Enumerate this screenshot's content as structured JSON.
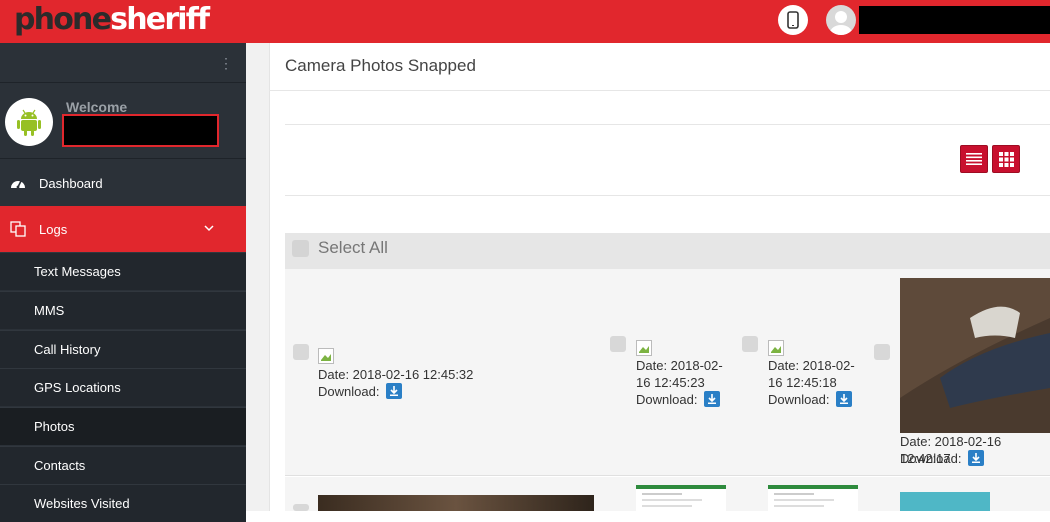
{
  "app": {
    "logo_phone": "phone",
    "logo_sheriff": "sheriff",
    "brand_color": "#e1272d"
  },
  "header": {
    "device_icon": "mobile-phone-icon",
    "avatar_icon": "user-avatar"
  },
  "sidebar": {
    "welcome": "Welcome",
    "profile_icon": "android-icon",
    "items": [
      {
        "label": "Dashboard",
        "icon": "dashboard-gauge-icon"
      },
      {
        "label": "Logs",
        "icon": "logs-copy-icon",
        "active": true,
        "expanded": true
      }
    ],
    "sub_items": [
      {
        "label": "Text Messages"
      },
      {
        "label": "MMS"
      },
      {
        "label": "Call History"
      },
      {
        "label": "GPS Locations"
      },
      {
        "label": "Photos",
        "active": true
      },
      {
        "label": "Contacts"
      },
      {
        "label": "Websites Visited"
      }
    ]
  },
  "main": {
    "title": "Camera Photos Snapped",
    "view_toggles": [
      {
        "icon": "list-view-icon"
      },
      {
        "icon": "grid-view-icon"
      }
    ],
    "select_all_label": "Select All",
    "download_label": "Download:",
    "photos": [
      {
        "date_line1": "Date: 2018-02-16 12:45:32",
        "date_line2": ""
      },
      {
        "date_line1": "Date: 2018-02-",
        "date_line2": "16 12:45:23"
      },
      {
        "date_line1": "Date: 2018-02-",
        "date_line2": "16 12:45:18"
      },
      {
        "date_line1": "Date: 2018-02-16 12:42:17",
        "date_line2": ""
      }
    ]
  }
}
